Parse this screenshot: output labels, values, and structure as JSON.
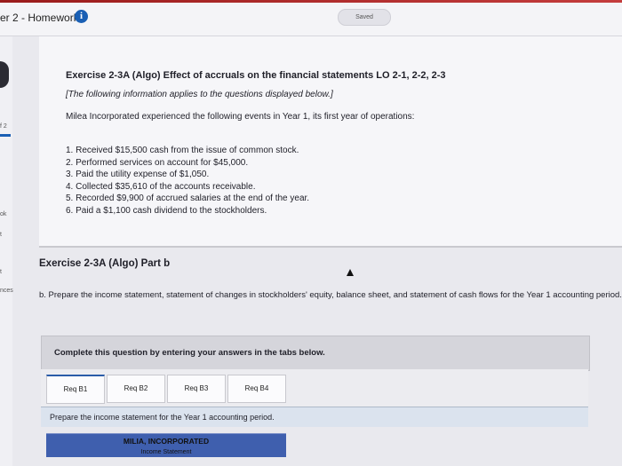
{
  "header": {
    "title": "er 2 - Homework",
    "info_icon": "info-icon",
    "saved_label": "Saved"
  },
  "sidebar": {
    "labels": [
      "f 2",
      "ok",
      "t",
      "t",
      "nces"
    ]
  },
  "exercise": {
    "heading": "Exercise 2-3A (Algo) Effect of accruals on the financial statements LO 2-1, 2-2, 2-3",
    "note": "[The following information applies to the questions displayed below.]",
    "intro": "Milea Incorporated experienced the following events in Year 1, its first year of operations:",
    "events": [
      "1. Received $15,500 cash from the issue of common stock.",
      "2. Performed services on account for $45,000.",
      "3. Paid the utility expense of $1,050.",
      "4. Collected $35,610 of the accounts receivable.",
      "5. Recorded $9,900 of accrued salaries at the end of the year.",
      "6. Paid a $1,100 cash dividend to the stockholders."
    ]
  },
  "part": {
    "title": "Exercise 2-3A (Algo) Part b",
    "text": "b. Prepare the income statement, statement of changes in stockholders' equity, balance sheet, and statement of cash flows for the Year 1 accounting period."
  },
  "instruction": "Complete this question by entering your answers in the tabs below.",
  "tabs": [
    "Req B1",
    "Req B2",
    "Req B3",
    "Req B4"
  ],
  "prep_text": "Prepare the income statement for the Year 1 accounting period.",
  "statement": {
    "company": "MILIA, INCORPORATED",
    "subtitle": "Income Statement"
  }
}
